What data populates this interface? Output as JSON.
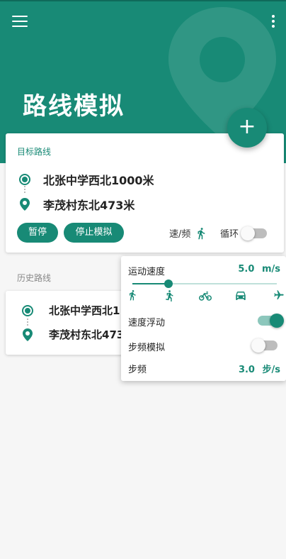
{
  "header": {
    "title": "路线模拟",
    "menu_icon": "menu-icon",
    "more_icon": "more-vertical-icon",
    "accent_color": "#188a76"
  },
  "fab": {
    "icon": "plus-icon",
    "label": "+"
  },
  "target_route": {
    "label": "目标路线",
    "start": "北张中学西北1000米",
    "end": "李茂村东北473米",
    "pause_button": "暂停",
    "stop_button": "停止模拟",
    "speed_freq_label": "速/频",
    "loop_label": "循环",
    "loop_enabled": false
  },
  "history": {
    "label": "历史路线",
    "items": [
      {
        "start": "北张中学西北1",
        "end": "李茂村东北473"
      }
    ]
  },
  "speed_popup": {
    "speed_label": "运动速度",
    "speed_value": "5.0",
    "speed_unit": "m/s",
    "slider_fraction": 0.25,
    "modes": [
      "walk-icon",
      "run-icon",
      "bike-icon",
      "car-icon",
      "plane-icon"
    ],
    "float_label": "速度浮动",
    "float_enabled": true,
    "cadence_sim_label": "步频模拟",
    "cadence_sim_enabled": false,
    "cadence_label": "步频",
    "cadence_value": "3.0",
    "cadence_unit": "步/s"
  }
}
